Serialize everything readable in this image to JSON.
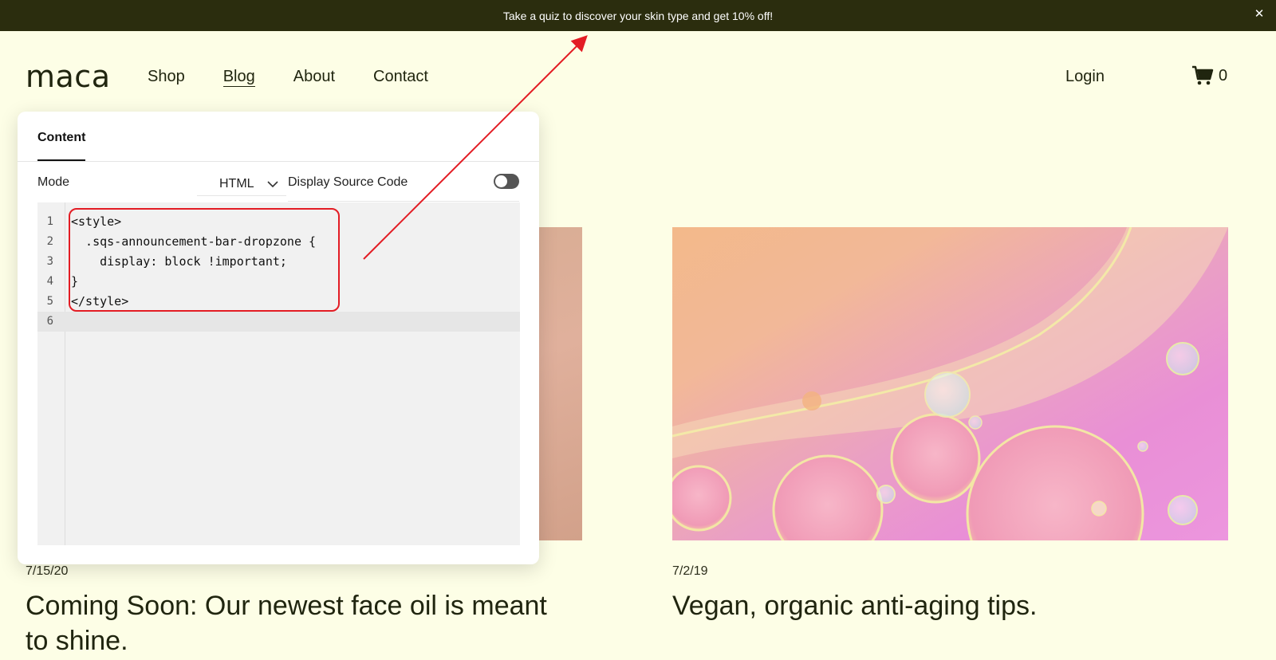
{
  "announcement": {
    "text": "Take a quiz to discover your skin type and get 10% off!",
    "close_icon": "close-icon",
    "colors": {
      "background": "#2b2d0e",
      "text": "#ffffff"
    }
  },
  "header": {
    "logo": "maca",
    "nav": [
      "Shop",
      "Blog",
      "About",
      "Contact"
    ],
    "active_nav": "Blog",
    "login": "Login",
    "cart_count": "0"
  },
  "panel": {
    "tab": "Content",
    "mode_label": "Mode",
    "mode_value": "HTML",
    "display_source_label": "Display Source Code",
    "display_source_on": false,
    "editor": {
      "line_numbers": [
        "1",
        "2",
        "3",
        "4",
        "5",
        "6"
      ],
      "lines": [
        "<style>",
        "  .sqs-announcement-bar-dropzone {",
        "    display: block !important;",
        "}",
        "</style>",
        ""
      ],
      "highlight_color": "#e31c24"
    }
  },
  "posts": [
    {
      "date": "7/15/20",
      "title": "Coming Soon: Our newest face oil is meant to shine."
    },
    {
      "date": "7/2/19",
      "title": "Vegan, organic anti-aging tips."
    }
  ],
  "colors": {
    "page_background": "#fdfee6",
    "annotation": "#e31c24"
  }
}
